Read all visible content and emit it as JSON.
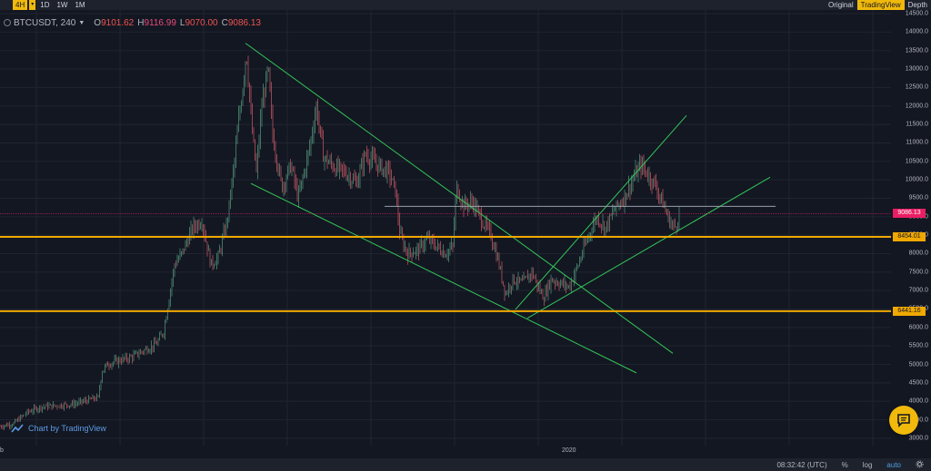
{
  "toolbar": {
    "intervals": [
      "4H",
      "1D",
      "1W",
      "1M"
    ],
    "active_interval": "4H",
    "views": [
      "Original",
      "TradingView",
      "Depth"
    ],
    "active_view": "TradingView"
  },
  "legend": {
    "symbol": "BTCUSDT, 240",
    "open_label": "O",
    "open": "9101.62",
    "high_label": "H",
    "high": "9116.99",
    "low_label": "L",
    "low": "9070.00",
    "close_label": "C",
    "close": "9086.13"
  },
  "chart_data": {
    "type": "candlestick",
    "ylim": [
      2800,
      14600
    ],
    "yticks": [
      3000,
      3500,
      4000,
      4500,
      5000,
      5500,
      6000,
      6500,
      7000,
      7500,
      8000,
      8500,
      9000,
      9500,
      10000,
      10500,
      11000,
      11500,
      12000,
      12500,
      13000,
      13500,
      14000,
      14500
    ],
    "close_path": [
      [
        0,
        3320
      ],
      [
        15,
        3400
      ],
      [
        30,
        3700
      ],
      [
        45,
        3850
      ],
      [
        60,
        3880
      ],
      [
        80,
        3920
      ],
      [
        100,
        4050
      ],
      [
        108,
        4100
      ],
      [
        112,
        4800
      ],
      [
        118,
        5000
      ],
      [
        130,
        5100
      ],
      [
        145,
        5200
      ],
      [
        160,
        5400
      ],
      [
        172,
        5550
      ],
      [
        180,
        5900
      ],
      [
        186,
        6800
      ],
      [
        192,
        7700
      ],
      [
        200,
        8000
      ],
      [
        212,
        8700
      ],
      [
        222,
        8900
      ],
      [
        232,
        7700
      ],
      [
        240,
        7900
      ],
      [
        250,
        8900
      ],
      [
        258,
        10500
      ],
      [
        262,
        11500
      ],
      [
        266,
        12300
      ],
      [
        271,
        13500
      ],
      [
        277,
        11400
      ],
      [
        282,
        10200
      ],
      [
        288,
        12000
      ],
      [
        295,
        13000
      ],
      [
        300,
        11200
      ],
      [
        310,
        9800
      ],
      [
        320,
        10400
      ],
      [
        328,
        9500
      ],
      [
        340,
        10800
      ],
      [
        348,
        12000
      ],
      [
        356,
        10600
      ],
      [
        370,
        10300
      ],
      [
        380,
        10200
      ],
      [
        392,
        9900
      ],
      [
        402,
        10700
      ],
      [
        415,
        10400
      ],
      [
        428,
        10200
      ],
      [
        435,
        9700
      ],
      [
        440,
        8500
      ],
      [
        448,
        8000
      ],
      [
        460,
        8100
      ],
      [
        470,
        8400
      ],
      [
        480,
        8200
      ],
      [
        490,
        8000
      ],
      [
        498,
        8200
      ],
      [
        502,
        9800
      ],
      [
        510,
        9300
      ],
      [
        520,
        9400
      ],
      [
        530,
        8900
      ],
      [
        540,
        8500
      ],
      [
        548,
        7800
      ],
      [
        556,
        6900
      ],
      [
        564,
        7300
      ],
      [
        575,
        7200
      ],
      [
        585,
        7500
      ],
      [
        592,
        7100
      ],
      [
        598,
        6800
      ],
      [
        606,
        7300
      ],
      [
        616,
        7200
      ],
      [
        626,
        7100
      ],
      [
        636,
        7700
      ],
      [
        646,
        8400
      ],
      [
        656,
        9000
      ],
      [
        666,
        8700
      ],
      [
        676,
        9200
      ],
      [
        686,
        9500
      ],
      [
        696,
        10000
      ],
      [
        705,
        10400
      ],
      [
        714,
        10100
      ],
      [
        722,
        9800
      ],
      [
        730,
        9300
      ],
      [
        736,
        8900
      ],
      [
        742,
        8700
      ],
      [
        748,
        9086
      ]
    ],
    "horizontal_lines": [
      {
        "price": 8454.01,
        "label": "8454.01",
        "color": "#f0a800"
      },
      {
        "price": 6441.16,
        "label": "6441.16",
        "color": "#f0a800"
      },
      {
        "price": 9086.13,
        "label": "9086.13",
        "color": "#e91e63"
      }
    ],
    "short_gray_line": {
      "price": 9280,
      "x_start": 423,
      "x_end": 853
    },
    "trend_lines": [
      {
        "x1": 270,
        "y1": 13700,
        "x2": 740,
        "y2": 5300
      },
      {
        "x1": 276,
        "y1": 9900,
        "x2": 700,
        "y2": 4770
      },
      {
        "x1": 567,
        "y1": 6490,
        "x2": 755,
        "y2": 11740
      },
      {
        "x1": 580,
        "y1": 6250,
        "x2": 847,
        "y2": 10070
      }
    ],
    "time_ticks": [
      {
        "x": 0,
        "label": "b"
      },
      {
        "x": 618,
        "label": "2020"
      }
    ]
  },
  "credit": {
    "text": "Chart by TradingView"
  },
  "bottom": {
    "time": "08:32:42 (UTC)",
    "percent": "%",
    "log": "log",
    "auto": "auto"
  },
  "colors": {
    "bg": "#131722",
    "up": "#26a69a",
    "down": "#ef5350",
    "accent": "#f0b90b",
    "trend": "#34c759"
  },
  "icons": {
    "settings": "gear-icon",
    "chat": "chat-icon"
  }
}
